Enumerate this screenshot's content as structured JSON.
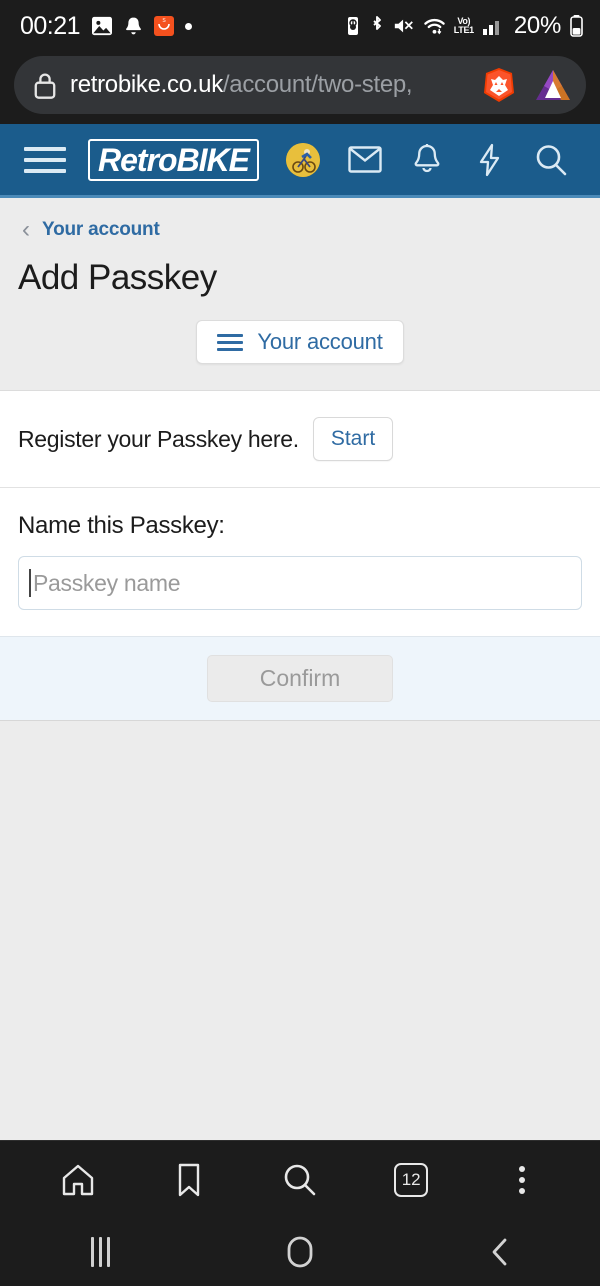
{
  "status_bar": {
    "time": "00:21",
    "battery_percent": "20%",
    "network_label_top": "Vo)",
    "network_label_bottom": "LTE1",
    "icons": [
      "screenshot-icon",
      "notification-bell-icon",
      "shopping-app-badge",
      "status-dot",
      "battery-saver-icon",
      "bluetooth-icon",
      "mute-icon",
      "wifi-icon",
      "volte-icon",
      "signal-bars-icon",
      "battery-icon"
    ]
  },
  "browser": {
    "url_domain": "retrobike.co.uk",
    "url_path": "/account/two-step,",
    "lock_icon": "lock-icon",
    "brave_shield_icon": "brave-lion-icon",
    "bat_icon": "bat-triangle-icon",
    "bottom_bar": {
      "home_label": "home-icon",
      "bookmark_label": "bookmark-icon",
      "search_label": "search-icon",
      "tab_count": "12",
      "menu_label": "kebab-menu-icon"
    }
  },
  "site_header": {
    "menu_icon": "hamburger-icon",
    "logo_text": "RetroBIKE",
    "avatar": "user-avatar",
    "icons": [
      "mail-icon",
      "bell-icon",
      "lightning-icon",
      "search-icon"
    ],
    "background_color": "#1b5c8c",
    "border_color": "#4b8ab8"
  },
  "page": {
    "breadcrumb": {
      "chevron": "‹",
      "label": "Your account"
    },
    "title": "Add Passkey",
    "account_button": {
      "label": "Your account",
      "icon": "hamburger-icon"
    },
    "register_row": {
      "label": "Register your Passkey here.",
      "start_button": "Start"
    },
    "name_row": {
      "label": "Name this Passkey:",
      "input_placeholder": "Passkey name",
      "input_value": ""
    },
    "footer": {
      "confirm_button": "Confirm",
      "confirm_disabled": true
    },
    "accent_color": "#2f6ba3",
    "background_color": "#ececec"
  },
  "android_nav": {
    "recents": "recents-icon",
    "home": "home-circle-icon",
    "back": "back-chevron-icon"
  }
}
